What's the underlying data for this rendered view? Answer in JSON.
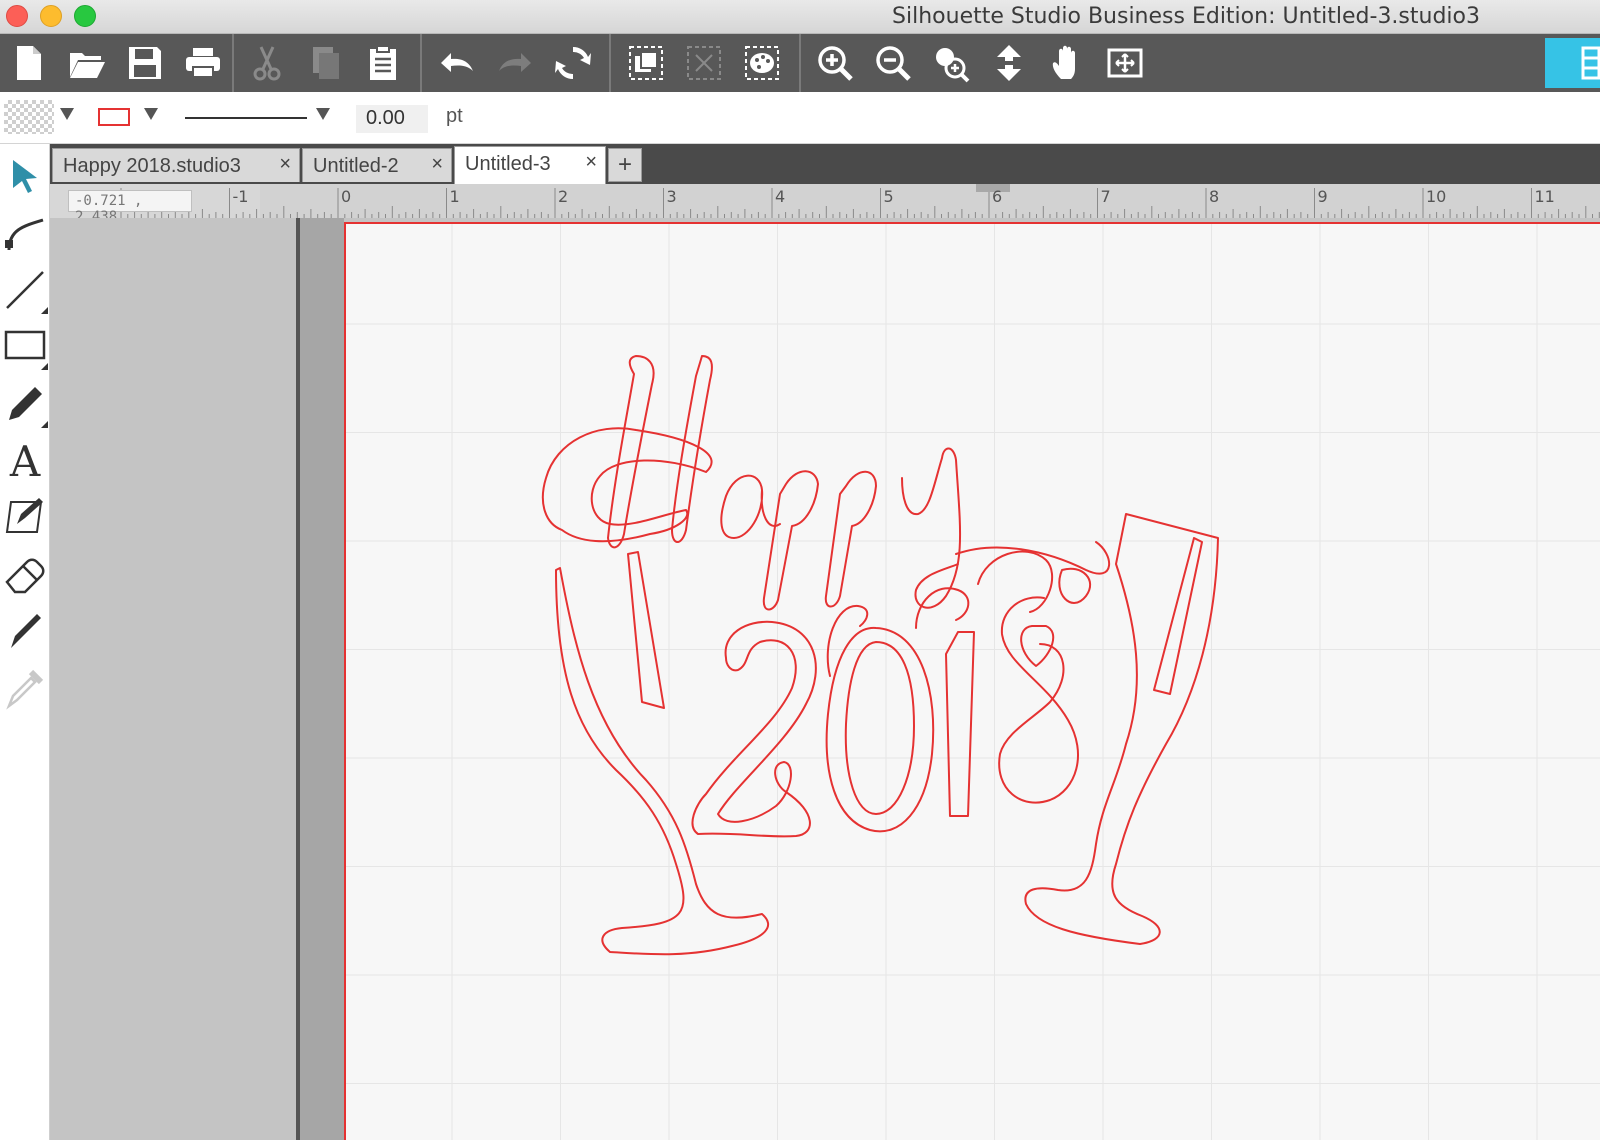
{
  "window": {
    "title": "Silhouette Studio Business Edition: Untitled-3.studio3"
  },
  "toolbar": {
    "icons": [
      "new-document-icon",
      "open-folder-icon",
      "save-icon",
      "print-icon",
      "cut-icon",
      "copy-icon",
      "paste-icon",
      "undo-icon",
      "redo-icon",
      "replicate-icon",
      "group-icon",
      "ungroup-icon",
      "color-palette-icon",
      "zoom-in-icon",
      "zoom-out-icon",
      "zoom-selection-icon",
      "fit-to-page-icon",
      "pan-hand-icon",
      "page-view-icon",
      "panel-toggle-icon"
    ],
    "accent": "#36c3e6"
  },
  "properties": {
    "line_width": "0.00",
    "unit": "pt",
    "line_color": "#e53232"
  },
  "tabs": [
    {
      "label": "Happy 2018.studio3",
      "close": "×"
    },
    {
      "label": "Untitled-2",
      "close": "×"
    },
    {
      "label": "Untitled-3",
      "close": "×"
    }
  ],
  "tab_add": "+",
  "ruler": {
    "coords": "-0.721 , 2.438",
    "labels": [
      "-1",
      "0",
      "1",
      "2",
      "3",
      "4",
      "5",
      "6",
      "7",
      "8",
      "9",
      "10",
      "11"
    ]
  },
  "design": {
    "word": "Happy",
    "year": "2018",
    "stroke_color": "#e53232"
  }
}
